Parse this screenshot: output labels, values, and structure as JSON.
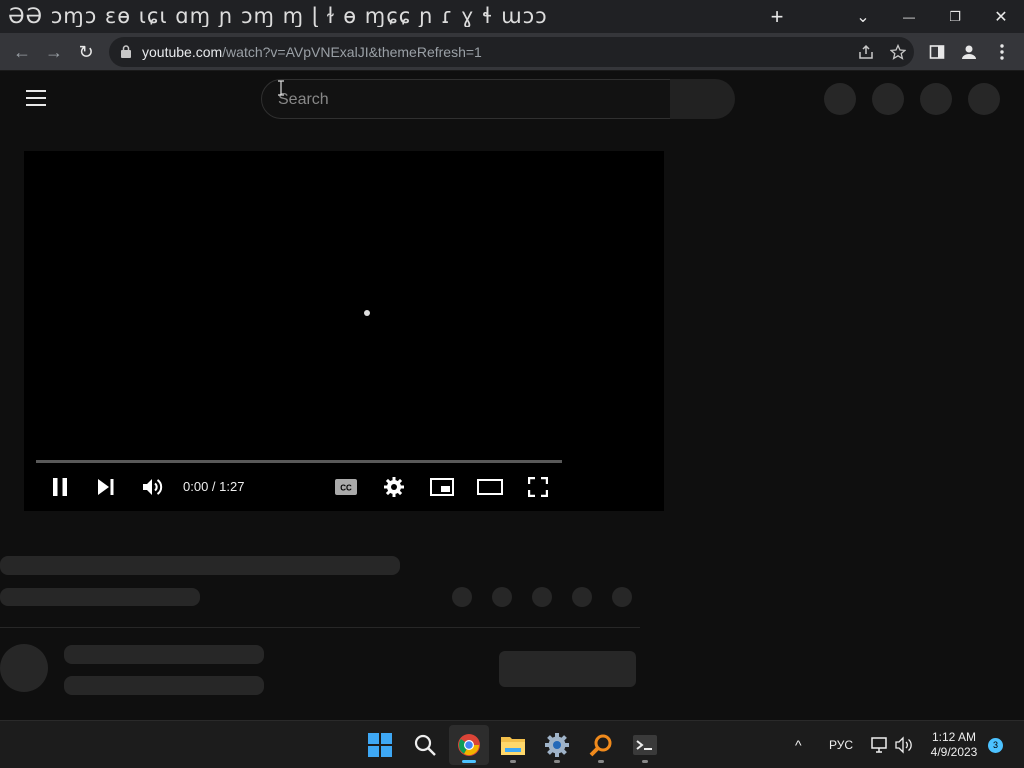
{
  "browser": {
    "tab_title": "ƏƏ ɔɱɔ ɛɵ ɩɕɩ ɑɱ ɲ ɔɱ ɱ ɭ ɫ ɵ ɱɕɕ ɲ ɾ ɣ ɬ ɯɔɔ",
    "new_tab_label": "+",
    "tab_search_label": "⌄",
    "minimize_label": "—",
    "restore_label": "❐",
    "close_label": "✕",
    "back_label": "←",
    "forward_label": "→",
    "reload_label": "↻",
    "url_host": "youtube.com",
    "url_path": "/watch?v=AVpVNExalJI&themeRefresh=1"
  },
  "youtube": {
    "search_placeholder": "Search",
    "player": {
      "time": "0:00 / 1:27",
      "progress": 0
    }
  },
  "taskbar": {
    "language": "РУС",
    "time": "1:12 AM",
    "date": "4/9/2023",
    "notification_count": "3",
    "tray_chevron": "^"
  },
  "colors": {
    "page_background": "#0f0f0f",
    "skeleton": "#272727",
    "player_background": "#000000",
    "notification_badge": "#4cc2ff"
  }
}
